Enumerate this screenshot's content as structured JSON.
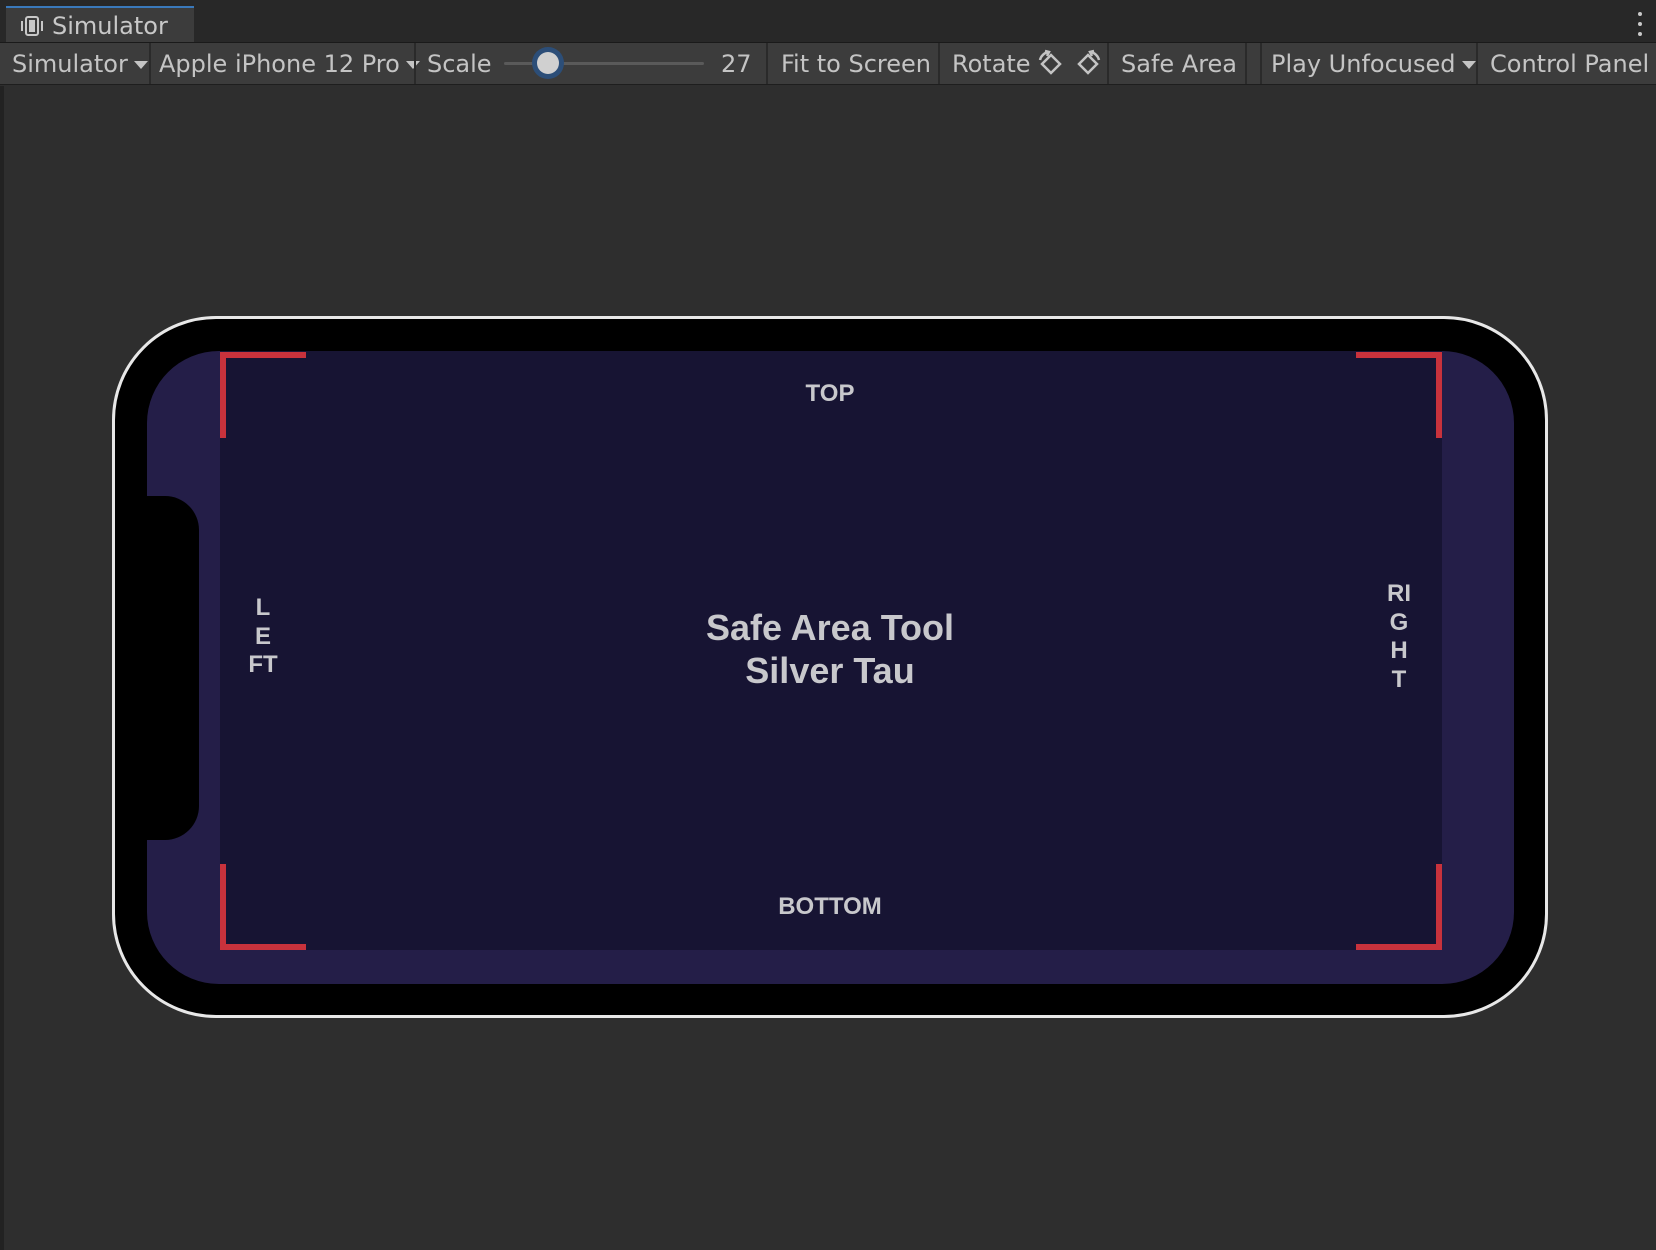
{
  "window": {
    "tab_label": "Simulator",
    "tab_icon": "simulator-device-icon",
    "menu_icon": "kebab-menu-icon"
  },
  "toolbar": {
    "mode_dropdown": "Simulator",
    "device_dropdown": "Apple iPhone 12 Pro",
    "scale_label": "Scale",
    "scale_value": "27",
    "scale_fraction": 0.22,
    "fit_to_screen": "Fit to Screen",
    "rotate_label": "Rotate",
    "rotate_left_icon": "rotate-counterclockwise-icon",
    "rotate_right_icon": "rotate-clockwise-icon",
    "safe_area": "Safe Area",
    "play_mode_dropdown": "Play Unfocused",
    "control_panel": "Control Panel"
  },
  "device_screen": {
    "label_top": "TOP",
    "label_bottom": "BOTTOM",
    "label_left": "LEFT",
    "label_right": "RIGHT",
    "title_line1": "Safe Area Tool",
    "title_line2": "Silver Tau"
  },
  "colors": {
    "editor_background": "#2e2e2e",
    "toolbar_background": "#3c3c3c",
    "screen_background": "#241e48",
    "safe_area_background": "#171433",
    "corner_marker": "#c8323c",
    "device_bezel": "#000000",
    "device_outline": "#e8e8e8",
    "tab_accent": "#3a79bb"
  }
}
